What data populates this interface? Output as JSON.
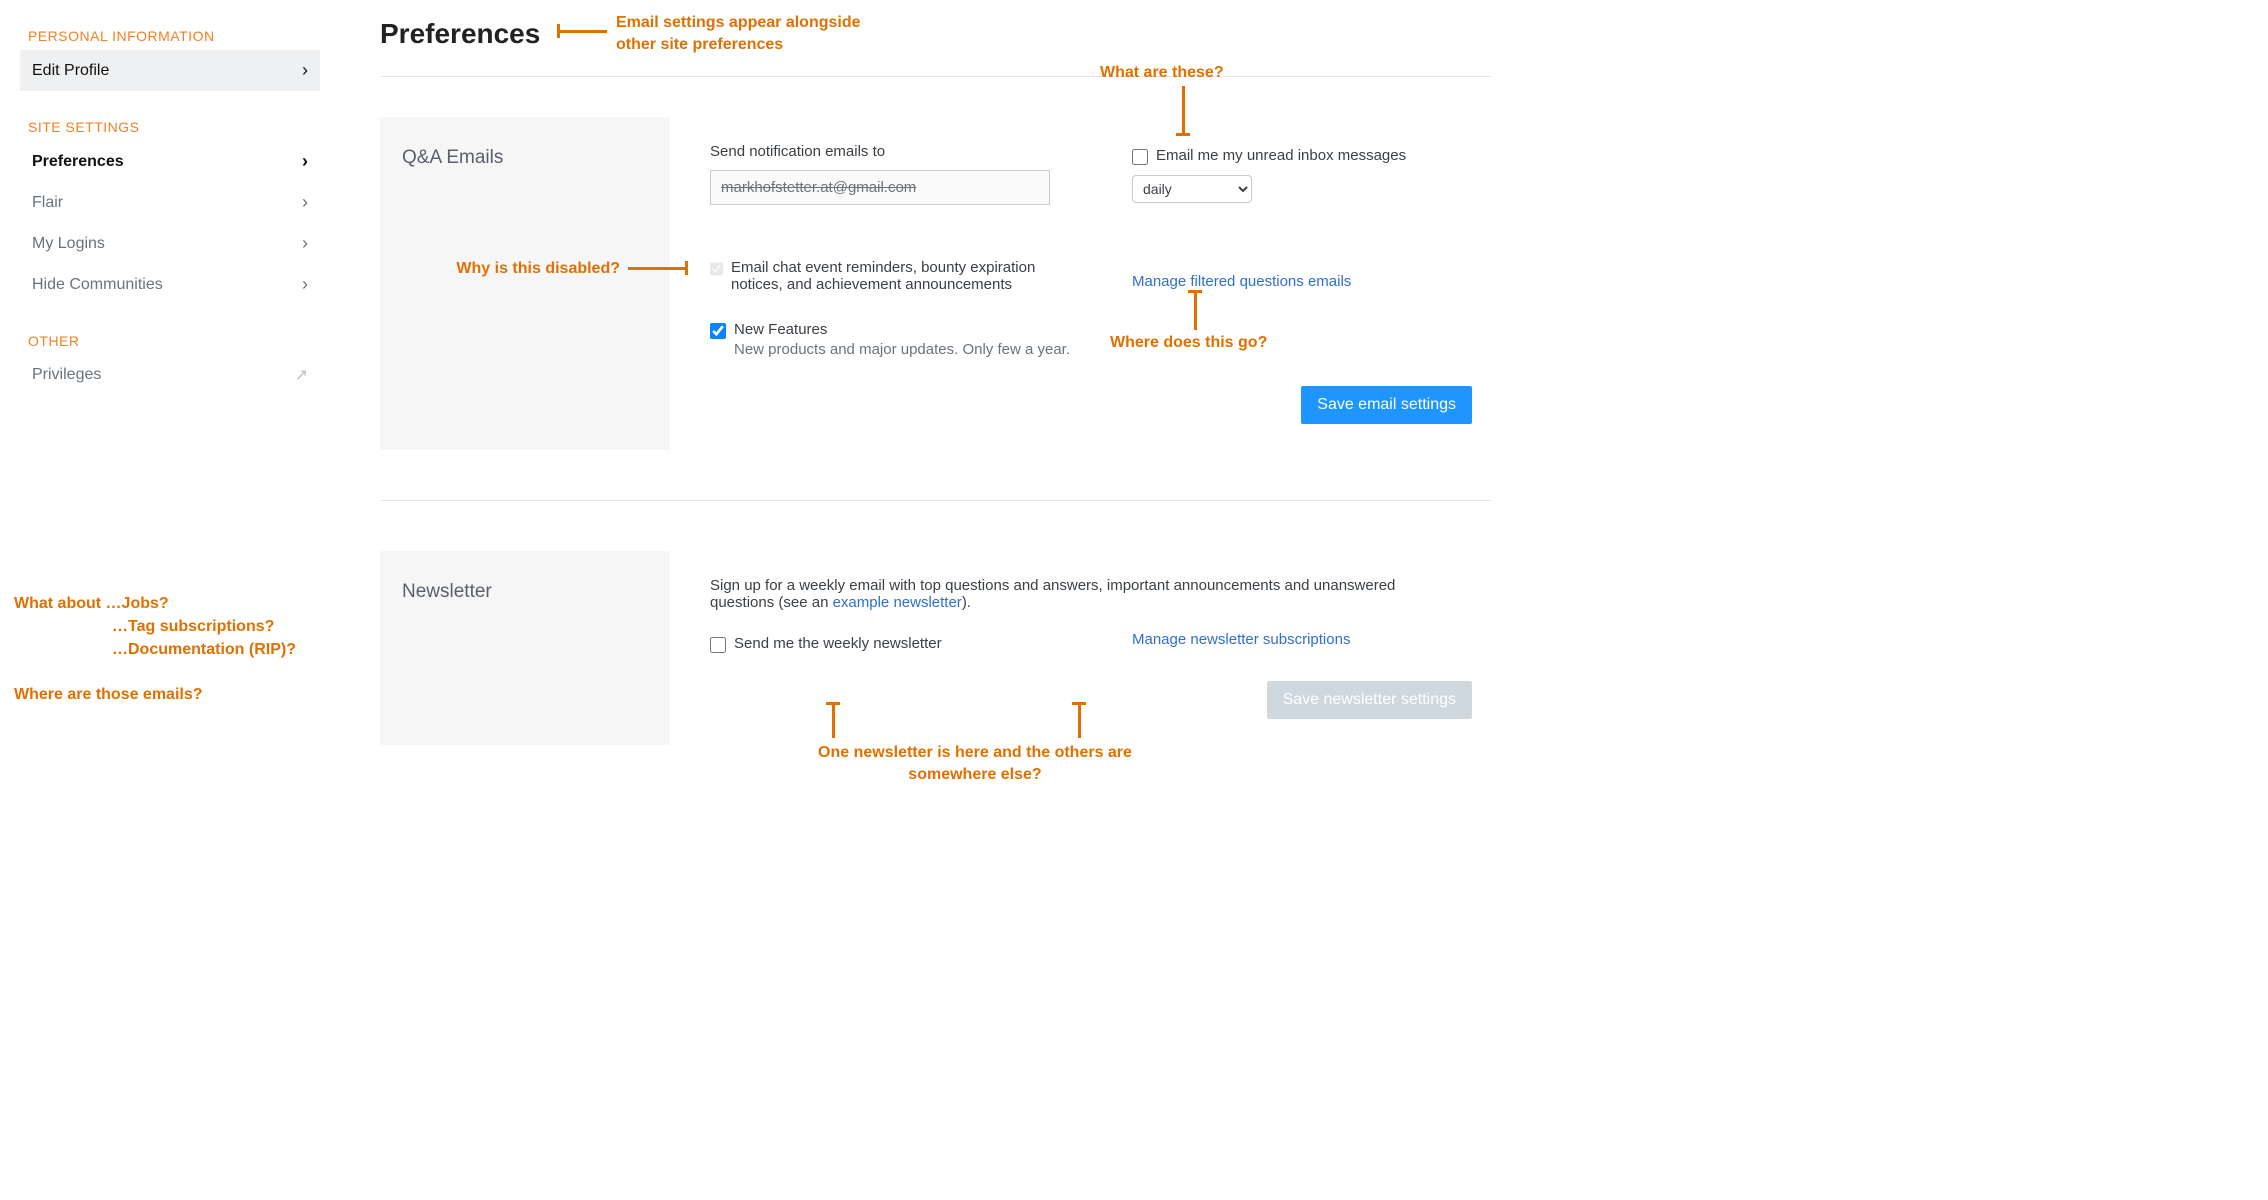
{
  "sidebar": {
    "personal_information": "Personal Information",
    "edit_profile": "Edit Profile",
    "site_settings": "Site Settings",
    "preferences": "Preferences",
    "flair": "Flair",
    "my_logins": "My Logins",
    "hide_communities": "Hide Communities",
    "other": "Other",
    "privileges": "Privileges"
  },
  "page_title": "Preferences",
  "qna": {
    "heading": "Q&A Emails",
    "send_to_label": "Send notification emails to",
    "email_value": "markhofstetter.at@gmail.com",
    "unread_label": "Email me my unread inbox messages",
    "unread_checked": false,
    "freq_value": "daily",
    "reminders_label": "Email chat event reminders, bounty expiration notices, and achievement announcements",
    "reminders_checked": true,
    "reminders_disabled": true,
    "new_features_title": "New Features",
    "new_features_sub": "New products and major updates. Only few a year.",
    "new_features_checked": true,
    "manage_filtered": "Manage filtered questions emails",
    "save_btn": "Save email settings"
  },
  "newsletter": {
    "heading": "Newsletter",
    "description_pre": "Sign up for a weekly email with top questions and answers, important announcements and unanswered questions (see an ",
    "example_link": "example newsletter",
    "description_post": ").",
    "send_weekly_label": "Send me the weekly newsletter",
    "send_weekly_checked": false,
    "manage_subs": "Manage newsletter subscriptions",
    "save_btn": "Save newsletter settings"
  },
  "annotations": {
    "appear_alongside": "Email settings appear alongside other site preferences",
    "what_are_these": "What are these?",
    "why_disabled": "Why is this disabled?",
    "where_does_this_go": "Where does this go?",
    "what_about_jobs": "What about …Jobs?",
    "tag_subs": "…Tag subscriptions?",
    "documentation": "…Documentation (RIP)?",
    "where_emails": "Where are those emails?",
    "one_newsletter": "One newsletter is here and the others are somewhere else?"
  }
}
